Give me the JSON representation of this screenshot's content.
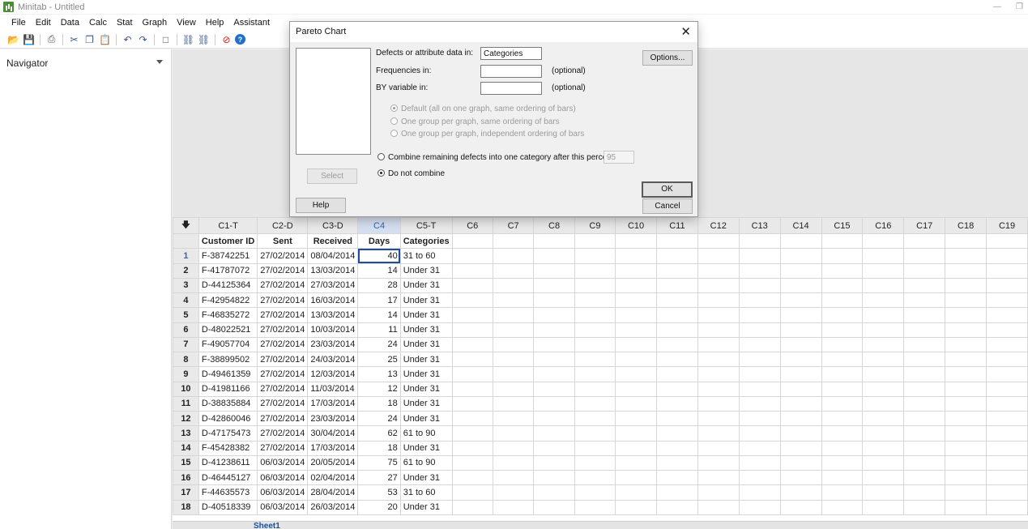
{
  "window": {
    "title": "Minitab - Untitled"
  },
  "menu": [
    "File",
    "Edit",
    "Data",
    "Calc",
    "Stat",
    "Graph",
    "View",
    "Help",
    "Assistant"
  ],
  "navigator": {
    "title": "Navigator"
  },
  "dialog": {
    "title": "Pareto Chart",
    "defects_label": "Defects or attribute data in:",
    "defects_value": "Categories",
    "frequencies_label": "Frequencies in:",
    "frequencies_value": "",
    "frequencies_optional": "(optional)",
    "by_label": "BY variable in:",
    "by_value": "",
    "by_optional": "(optional)",
    "opt_default": "Default (all on one graph, same ordering of bars)",
    "opt_group_same": "One group per graph, same ordering of bars",
    "opt_group_indep": "One group per graph, independent ordering of bars",
    "combine_label": "Combine remaining defects into one category after this percent:",
    "combine_value": "95",
    "no_combine_label": "Do not combine",
    "select_button": "Select",
    "help_button": "Help",
    "options_button": "Options...",
    "ok_button": "OK",
    "cancel_button": "Cancel"
  },
  "worksheet": {
    "columns": [
      "C1-T",
      "C2-D",
      "C3-D",
      "C4",
      "C5-T",
      "C6",
      "C7",
      "C8",
      "C9",
      "C10",
      "C11",
      "C12",
      "C13",
      "C14",
      "C15",
      "C16",
      "C17",
      "C18",
      "C19"
    ],
    "names": [
      "Customer ID",
      "Sent",
      "Received",
      "Days",
      "Categories",
      "",
      "",
      "",
      "",
      "",
      "",
      "",
      "",
      "",
      "",
      "",
      "",
      "",
      ""
    ],
    "rows": [
      [
        "F-38742251",
        "27/02/2014",
        "08/04/2014",
        "40",
        "31 to 60"
      ],
      [
        "F-41787072",
        "27/02/2014",
        "13/03/2014",
        "14",
        "Under 31"
      ],
      [
        "D-44125364",
        "27/02/2014",
        "27/03/2014",
        "28",
        "Under 31"
      ],
      [
        "F-42954822",
        "27/02/2014",
        "16/03/2014",
        "17",
        "Under 31"
      ],
      [
        "F-46835272",
        "27/02/2014",
        "13/03/2014",
        "14",
        "Under 31"
      ],
      [
        "D-48022521",
        "27/02/2014",
        "10/03/2014",
        "11",
        "Under 31"
      ],
      [
        "F-49057704",
        "27/02/2014",
        "23/03/2014",
        "24",
        "Under 31"
      ],
      [
        "F-38899502",
        "27/02/2014",
        "24/03/2014",
        "25",
        "Under 31"
      ],
      [
        "D-49461359",
        "27/02/2014",
        "12/03/2014",
        "13",
        "Under 31"
      ],
      [
        "D-41981166",
        "27/02/2014",
        "11/03/2014",
        "12",
        "Under 31"
      ],
      [
        "D-38835884",
        "27/02/2014",
        "17/03/2014",
        "18",
        "Under 31"
      ],
      [
        "D-42860046",
        "27/02/2014",
        "23/03/2014",
        "24",
        "Under 31"
      ],
      [
        "D-47175473",
        "27/02/2014",
        "30/04/2014",
        "62",
        "61 to 90"
      ],
      [
        "F-45428382",
        "27/02/2014",
        "17/03/2014",
        "18",
        "Under 31"
      ],
      [
        "D-41238611",
        "06/03/2014",
        "20/05/2014",
        "75",
        "61 to 90"
      ],
      [
        "D-46445127",
        "06/03/2014",
        "02/04/2014",
        "27",
        "Under 31"
      ],
      [
        "F-44635573",
        "06/03/2014",
        "28/04/2014",
        "53",
        "31 to 60"
      ],
      [
        "D-40518339",
        "06/03/2014",
        "26/03/2014",
        "20",
        "Under 31"
      ]
    ],
    "active_column": "C4",
    "active_row": 1,
    "sheet_tab": "Sheet1"
  }
}
